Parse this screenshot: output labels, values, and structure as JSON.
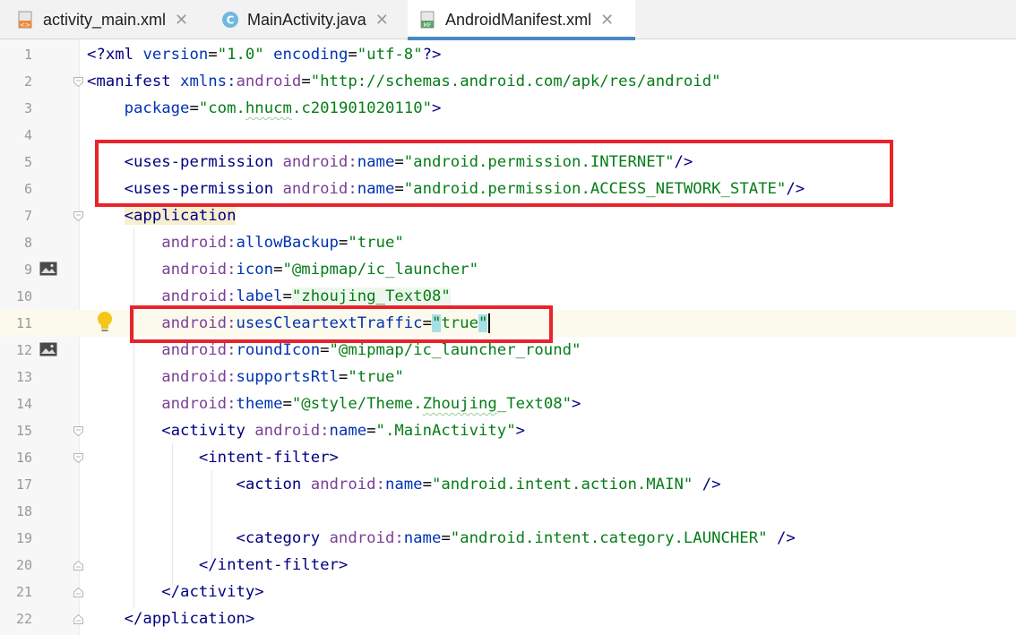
{
  "tabs": [
    {
      "label": "activity_main.xml",
      "icon": "xml-file-icon",
      "active": false
    },
    {
      "label": "MainActivity.java",
      "icon": "java-class-icon",
      "active": false
    },
    {
      "label": "AndroidManifest.xml",
      "icon": "manifest-file-icon",
      "active": true
    }
  ],
  "close_glyph": "✕",
  "colors": {
    "accent": "#4a88c7",
    "highlight_box": "#e8232a",
    "tag": "#000080",
    "attribute_ns": "#7b3f98",
    "attribute": "#0033b3",
    "string": "#067d17"
  },
  "line_numbers": [
    "1",
    "2",
    "3",
    "4",
    "5",
    "6",
    "7",
    "8",
    "9",
    "10",
    "11",
    "12",
    "13",
    "14",
    "15",
    "16",
    "17",
    "18",
    "19",
    "20",
    "21",
    "22"
  ],
  "code": {
    "l1": {
      "open": "<?",
      "tag": "xml",
      "attr1": "version",
      "val1": "\"1.0\"",
      "attr2": "encoding",
      "val2": "\"utf-8\"",
      "close": "?>"
    },
    "l2": {
      "tag": "<manifest",
      "ns": "xmlns:",
      "attr": "android",
      "val": "\"http://schemas.android.com/apk/res/android\""
    },
    "l3": {
      "attr": "package",
      "val_a": "\"com.",
      "val_b": "hnucm",
      "val_c": ".c201901020110\"",
      "close": ">"
    },
    "l5": {
      "tag": "<uses-permission",
      "ns": "android:",
      "attr": "name",
      "val": "\"android.permission.INTERNET\"",
      "close": "/>"
    },
    "l6": {
      "tag": "<uses-permission",
      "ns": "android:",
      "attr": "name",
      "val": "\"android.permission.ACCESS_NETWORK_STATE\"",
      "close": "/>"
    },
    "l7": {
      "tag": "<application"
    },
    "l8": {
      "ns": "android:",
      "attr": "allowBackup",
      "val": "\"true\""
    },
    "l9": {
      "ns": "android:",
      "attr": "icon",
      "val": "\"@mipmap/ic_launcher\""
    },
    "l10": {
      "ns": "android:",
      "attr": "label",
      "val": "\"zhoujing_Text08\""
    },
    "l11": {
      "ns": "android:",
      "attr": "usesCleartextTraffic",
      "q1": "\"",
      "val": "true",
      "q2": "\""
    },
    "l12": {
      "ns": "android:",
      "attr": "roundIcon",
      "val": "\"@mipmap/ic_launcher_round\""
    },
    "l13": {
      "ns": "android:",
      "attr": "supportsRtl",
      "val": "\"true\""
    },
    "l14": {
      "ns": "android:",
      "attr": "theme",
      "val_a": "\"@style/Theme.",
      "val_b": "Zhoujing",
      "val_c": "_Text08\"",
      "close": ">"
    },
    "l15": {
      "tag": "<activity",
      "ns": "android:",
      "attr": "name",
      "val": "\".MainActivity\"",
      "close": ">"
    },
    "l16": {
      "tag": "<intent-filter",
      "close": ">"
    },
    "l17": {
      "tag": "<action",
      "ns": "android:",
      "attr": "name",
      "val": "\"android.intent.action.MAIN\"",
      "close": "/>"
    },
    "l19": {
      "tag": "<category",
      "ns": "android:",
      "attr": "name",
      "val": "\"android.intent.category.LAUNCHER\"",
      "close": "/>"
    },
    "l20": {
      "tag": "</intent-filter>"
    },
    "l21": {
      "tag": "</activity>"
    },
    "l22": {
      "tag": "</application>"
    }
  }
}
